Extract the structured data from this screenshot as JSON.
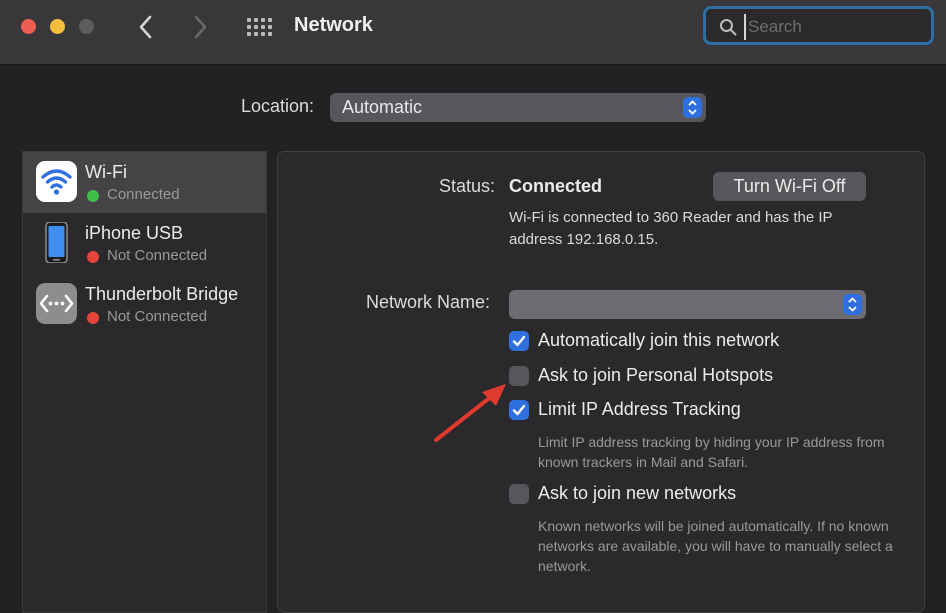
{
  "window": {
    "title": "Network",
    "search_placeholder": "Search"
  },
  "location": {
    "label": "Location:",
    "value": "Automatic"
  },
  "sidebar": {
    "items": [
      {
        "name": "Wi-Fi",
        "status": "Connected",
        "icon": "wifi-icon",
        "status_color": "#3fbf4a",
        "selected": true
      },
      {
        "name": "iPhone USB",
        "status": "Not Connected",
        "icon": "iphone-icon",
        "status_color": "#e5443b",
        "selected": false
      },
      {
        "name": "Thunderbolt Bridge",
        "status": "Not Connected",
        "icon": "thunderbolt-bridge-icon",
        "status_color": "#e5443b",
        "selected": false
      }
    ]
  },
  "detail": {
    "status_label": "Status:",
    "status_value": "Connected",
    "turn_off_button": "Turn Wi-Fi Off",
    "status_description": "Wi-Fi is connected to 360 Reader and has the IP address 192.168.0.15.",
    "network_name_label": "Network Name:",
    "network_name_value": "",
    "options": [
      {
        "label": "Automatically join this network",
        "checked": true
      },
      {
        "label": "Ask to join Personal Hotspots",
        "checked": false
      },
      {
        "label": "Limit IP Address Tracking",
        "checked": true,
        "hint": "Limit IP address tracking by hiding your IP address from known trackers in Mail and Safari."
      },
      {
        "label": "Ask to join new networks",
        "checked": false,
        "hint": "Known networks will be joined automatically. If no known networks are available, you will have to manually select a network."
      }
    ]
  },
  "colors": {
    "accent": "#2f6fe0",
    "annotation_arrow": "#e0392e"
  }
}
